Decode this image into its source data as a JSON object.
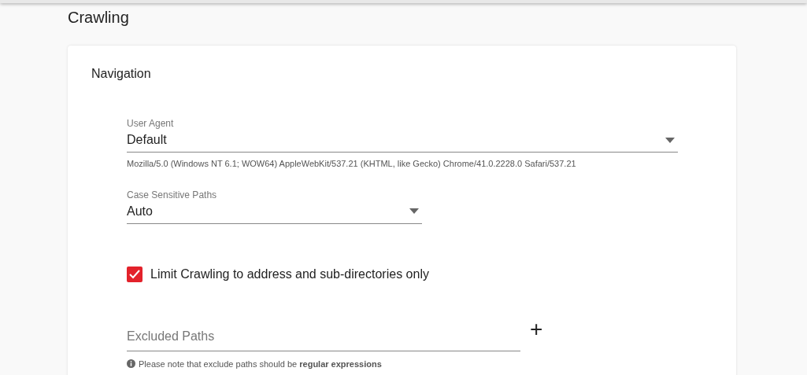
{
  "page_title": "Crawling",
  "section_title": "Navigation",
  "user_agent": {
    "label": "User Agent",
    "value": "Default",
    "hint": "Mozilla/5.0 (Windows NT 6.1; WOW64) AppleWebKit/537.21 (KHTML, like Gecko) Chrome/41.0.2228.0 Safari/537.21"
  },
  "case_sensitive": {
    "label": "Case Sensitive Paths",
    "value": "Auto"
  },
  "limit_crawling": {
    "label": "Limit Crawling to address and sub-directories only",
    "checked": true
  },
  "excluded_paths": {
    "placeholder": "Excluded Paths",
    "add_label": "+",
    "note": "Please note that exclude paths should be **regular expressions**"
  }
}
